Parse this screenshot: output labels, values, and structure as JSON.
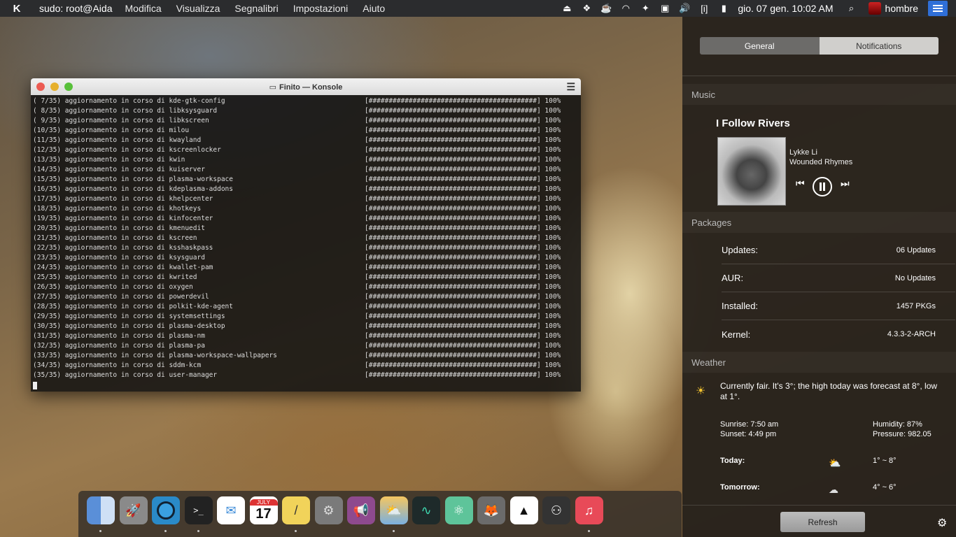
{
  "topbar": {
    "app_title": "sudo: root@Aida",
    "menu": [
      "Modifica",
      "Visualizza",
      "Segnalibri",
      "Impostazioni",
      "Aiuto"
    ],
    "clock": "gio. 07 gen. 10:02 AM",
    "user": "hombre",
    "tray_bracket": "[i]"
  },
  "konsole": {
    "title": "Finito — Konsole",
    "lines": [
      {
        "left": "( 7/35) aggiornamento in corso di kde-gtk-config",
        "right": "[##########################################] 100%"
      },
      {
        "left": "( 8/35) aggiornamento in corso di libksysguard",
        "right": "[##########################################] 100%"
      },
      {
        "left": "( 9/35) aggiornamento in corso di libkscreen",
        "right": "[##########################################] 100%"
      },
      {
        "left": "(10/35) aggiornamento in corso di milou",
        "right": "[##########################################] 100%"
      },
      {
        "left": "(11/35) aggiornamento in corso di kwayland",
        "right": "[##########################################] 100%"
      },
      {
        "left": "(12/35) aggiornamento in corso di kscreenlocker",
        "right": "[##########################################] 100%"
      },
      {
        "left": "(13/35) aggiornamento in corso di kwin",
        "right": "[##########################################] 100%"
      },
      {
        "left": "(14/35) aggiornamento in corso di kuiserver",
        "right": "[##########################################] 100%"
      },
      {
        "left": "(15/35) aggiornamento in corso di plasma-workspace",
        "right": "[##########################################] 100%"
      },
      {
        "left": "(16/35) aggiornamento in corso di kdeplasma-addons",
        "right": "[##########################################] 100%"
      },
      {
        "left": "(17/35) aggiornamento in corso di khelpcenter",
        "right": "[##########################################] 100%"
      },
      {
        "left": "(18/35) aggiornamento in corso di khotkeys",
        "right": "[##########################################] 100%"
      },
      {
        "left": "(19/35) aggiornamento in corso di kinfocenter",
        "right": "[##########################################] 100%"
      },
      {
        "left": "(20/35) aggiornamento in corso di kmenuedit",
        "right": "[##########################################] 100%"
      },
      {
        "left": "(21/35) aggiornamento in corso di kscreen",
        "right": "[##########################################] 100%"
      },
      {
        "left": "(22/35) aggiornamento in corso di ksshaskpass",
        "right": "[##########################################] 100%"
      },
      {
        "left": "(23/35) aggiornamento in corso di ksysguard",
        "right": "[##########################################] 100%"
      },
      {
        "left": "(24/35) aggiornamento in corso di kwallet-pam",
        "right": "[##########################################] 100%"
      },
      {
        "left": "(25/35) aggiornamento in corso di kwrited",
        "right": "[##########################################] 100%"
      },
      {
        "left": "(26/35) aggiornamento in corso di oxygen",
        "right": "[##########################################] 100%"
      },
      {
        "left": "(27/35) aggiornamento in corso di powerdevil",
        "right": "[##########################################] 100%"
      },
      {
        "left": "(28/35) aggiornamento in corso di polkit-kde-agent",
        "right": "[##########################################] 100%"
      },
      {
        "left": "(29/35) aggiornamento in corso di systemsettings",
        "right": "[##########################################] 100%"
      },
      {
        "left": "(30/35) aggiornamento in corso di plasma-desktop",
        "right": "[##########################################] 100%"
      },
      {
        "left": "(31/35) aggiornamento in corso di plasma-nm",
        "right": "[##########################################] 100%"
      },
      {
        "left": "(32/35) aggiornamento in corso di plasma-pa",
        "right": "[##########################################] 100%"
      },
      {
        "left": "(33/35) aggiornamento in corso di plasma-workspace-wallpapers",
        "right": "[##########################################] 100%"
      },
      {
        "left": "(34/35) aggiornamento in corso di sddm-kcm",
        "right": "[##########################################] 100%"
      },
      {
        "left": "(35/35) aggiornamento in corso di user-manager",
        "right": "[##########################################] 100%"
      }
    ]
  },
  "sidebar": {
    "tabs": [
      "General",
      "Notifications"
    ],
    "music": {
      "header": "Music",
      "song": "I Follow Rivers",
      "artist": "Lykke Li",
      "album": "Wounded Rhymes"
    },
    "packages": {
      "header": "Packages",
      "rows": [
        {
          "key": "Updates:",
          "value": "06 Updates"
        },
        {
          "key": "AUR:",
          "value": "No Updates"
        },
        {
          "key": "Installed:",
          "value": "1457 PKGs"
        },
        {
          "key": "Kernel:",
          "value": "4.3.3-2-ARCH"
        }
      ]
    },
    "weather": {
      "header": "Weather",
      "summary": "Currently fair.  It's 3°; the high today was forecast at 8°, low at 1°.",
      "sunrise": "Sunrise: 7:50 am",
      "sunset": "Sunset: 4:49 pm",
      "humidity": "Humidity: 87%",
      "pressure": "Pressure: 982.05",
      "today_label": "Today:",
      "today_range": "1° ~ 8°",
      "tomorrow_label": "Tomorrow:",
      "tomorrow_range": "4° ~ 6°"
    },
    "refresh_label": "Refresh"
  },
  "dock": {
    "calendar_month": "JULY",
    "calendar_day": "17",
    "icons": [
      "finder-icon",
      "rocket-launcher-icon",
      "browser-icon",
      "terminal-icon",
      "mail-icon",
      "calendar-icon",
      "notes-icon",
      "system-settings-icon",
      "announcement-icon",
      "weather-app-icon",
      "system-monitor-icon",
      "atom-icon",
      "gimp-icon",
      "inkscape-icon",
      "steam-icon",
      "music-icon"
    ],
    "terminal_glyph": ">_"
  },
  "colors": {
    "topbar_bg": "#2b2c2e",
    "accent_blue": "#2f6fd8",
    "close": "#ec5b52",
    "minimize": "#e6b02c",
    "maximize": "#58c03a"
  }
}
